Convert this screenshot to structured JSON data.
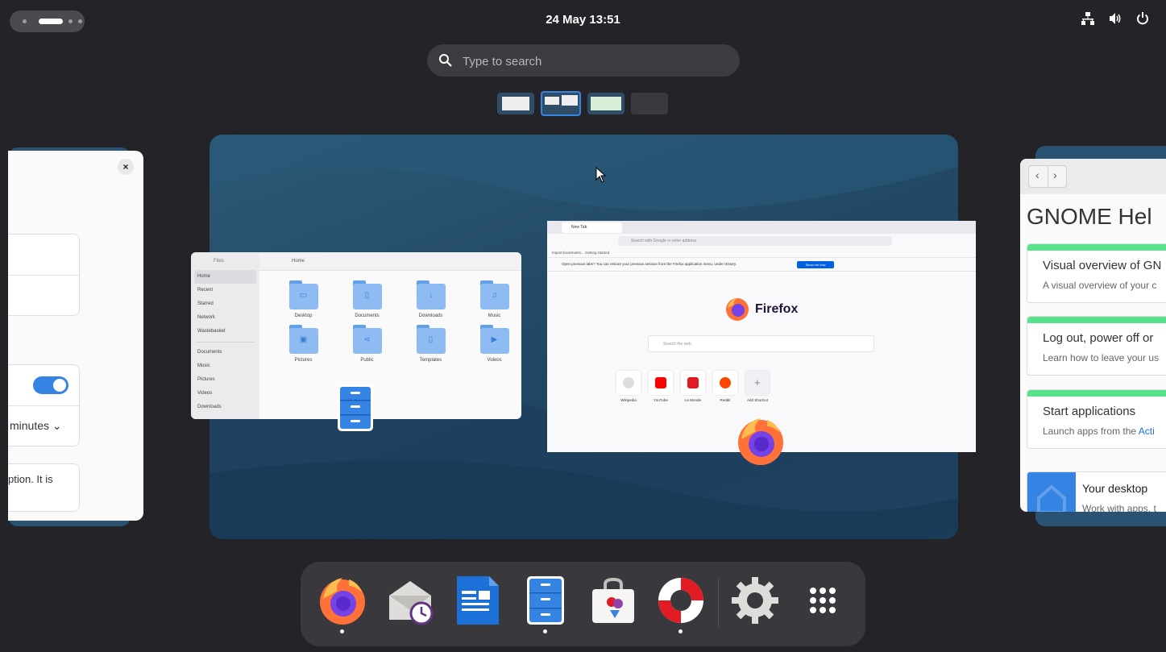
{
  "topbar": {
    "clock": "24 May  13:51",
    "system_icons": [
      "network-icon",
      "volume-icon",
      "power-icon"
    ]
  },
  "search": {
    "placeholder": "Type to search"
  },
  "workspaces": {
    "count": 4,
    "active_index": 1
  },
  "files_window": {
    "title": "Files",
    "location": "Home",
    "sidebar": [
      "Home",
      "Recent",
      "Starred",
      "Network",
      "Wastebasket",
      "Documents",
      "Music",
      "Pictures",
      "Videos",
      "Downloads"
    ],
    "folders": [
      "Desktop",
      "Documents",
      "Downloads",
      "Music",
      "Pictures",
      "Public",
      "Templates",
      "Videos"
    ]
  },
  "firefox_window": {
    "tab_title": "New Tab",
    "url_placeholder": "Search with Google or enter address",
    "bookmarks": "Import bookmarks...     Getting Started",
    "notice": "Open previous tabs?  You can restore your previous session from the Firefox application menu, under History.",
    "notice_button": "Show me how",
    "logo_text": "Firefox",
    "web_search_placeholder": "Search the web",
    "shortcuts": [
      "Wikipedia",
      "YouTube",
      "Le Monde",
      "Reddit",
      "Add Shortcut"
    ]
  },
  "settings_window": {
    "dropdown_text": "minutes",
    "description_fragment": "ption. It is"
  },
  "help_window": {
    "title": "GNOME Hel",
    "cards": [
      {
        "title": "Visual overview of GN",
        "subtitle": "A visual overview of your c",
        "link": ""
      },
      {
        "title": "Log out, power off or",
        "subtitle": "Learn how to leave your us",
        "link": ""
      },
      {
        "title": "Start applications",
        "subtitle": "Launch apps from the ",
        "link": "Acti"
      }
    ],
    "desktop_card": {
      "title": "Your desktop",
      "subtitle": "Work with apps, t"
    }
  },
  "dock": {
    "apps": [
      "firefox",
      "evolution-mail",
      "libreoffice-impress",
      "files",
      "software",
      "help",
      "settings",
      "show-apps"
    ],
    "running": [
      "firefox",
      "files",
      "help"
    ]
  },
  "colors": {
    "accent": "#3584e4",
    "background": "#242428",
    "dock": "#38383d"
  }
}
